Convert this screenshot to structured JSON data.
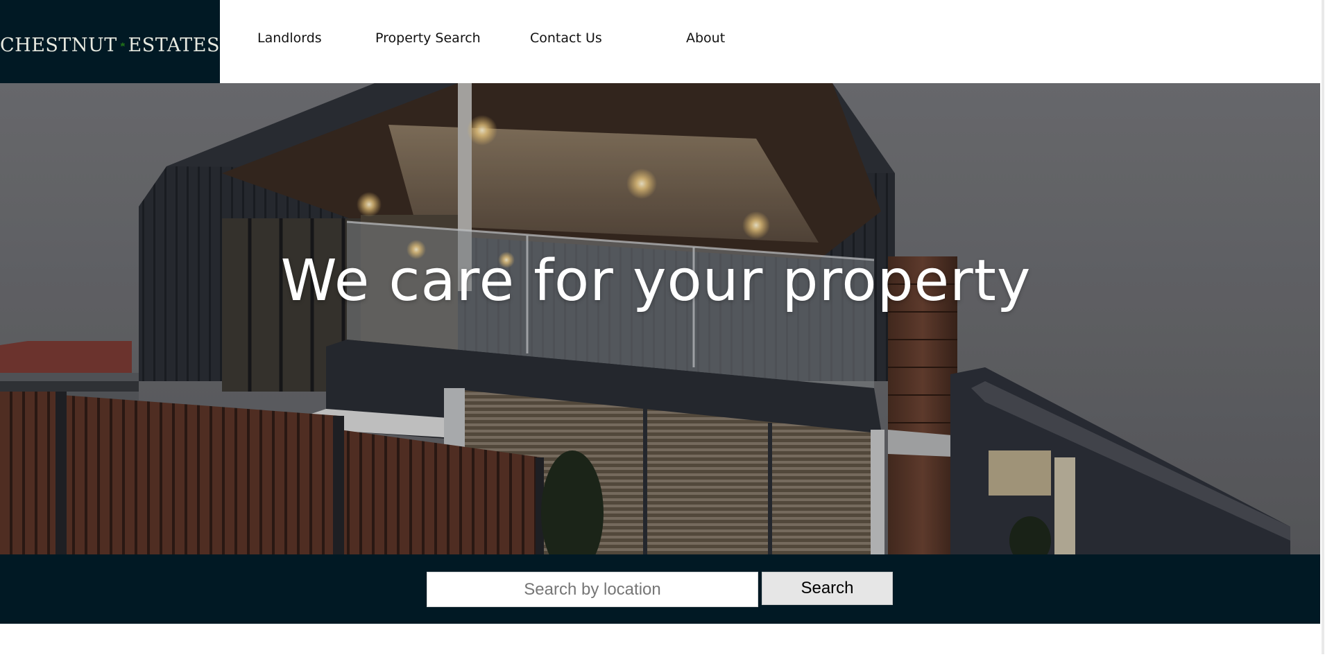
{
  "brand": {
    "name_left": "CHESTNUT",
    "name_right": "ESTATES",
    "logo_icon": "chestnut-leaf-icon",
    "bg_color": "#011924",
    "leaf_color": "#1f6b1a"
  },
  "nav": {
    "items": [
      {
        "label": "Landlords"
      },
      {
        "label": "Property Search"
      },
      {
        "label": "Contact Us"
      },
      {
        "label": "About"
      }
    ]
  },
  "hero": {
    "title": "We care for your property"
  },
  "search": {
    "placeholder": "Search by location",
    "value": "",
    "button_label": "Search"
  }
}
